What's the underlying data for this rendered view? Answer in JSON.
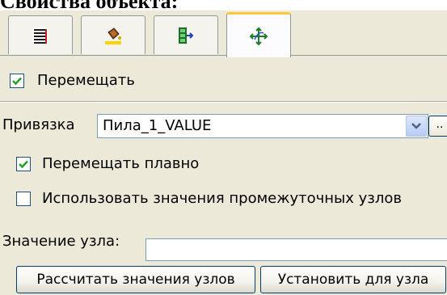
{
  "heading": "Свойства объекта:",
  "tabs": [
    {
      "icon": "list-icon",
      "active": false
    },
    {
      "icon": "paint-bucket-icon",
      "active": false
    },
    {
      "icon": "tree-structure-icon",
      "active": false
    },
    {
      "icon": "move-arrows-icon",
      "active": true
    }
  ],
  "move": {
    "checked": true,
    "label": "Перемещать"
  },
  "binding": {
    "label": "Привязка",
    "value": "Пила_1_VALUE",
    "browse_label": ".."
  },
  "smooth": {
    "checked": true,
    "label": "Перемещать плавно"
  },
  "intermediate": {
    "checked": false,
    "label": "Использовать значения промежуточных узлов"
  },
  "node_value": {
    "label": "Значение узла:",
    "value": ""
  },
  "buttons": {
    "calculate": "Рассчитать значения узлов",
    "set_for_node": "Установить для узла"
  },
  "colors": {
    "active_tab_accent": "#ffc83c",
    "check": "#21a121",
    "panel": "#ece9d8"
  }
}
